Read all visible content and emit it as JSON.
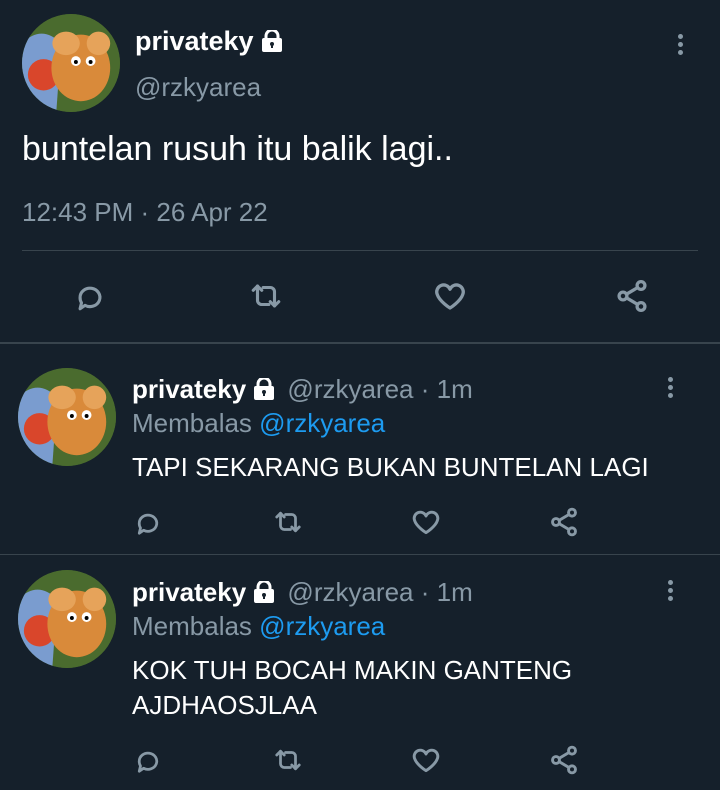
{
  "main_tweet": {
    "display_name": "privateky",
    "handle": "@rzkyarea",
    "text": "buntelan rusuh itu balik lagi..",
    "timestamp": "12:43 PM · 26 Apr 22"
  },
  "replies": [
    {
      "display_name": "privateky",
      "handle": "@rzkyarea",
      "time": "· 1m",
      "replying_prefix": "Membalas",
      "replying_to": "@rzkyarea",
      "text": "TAPI SEKARANG BUKAN BUNTELAN LAGI"
    },
    {
      "display_name": "privateky",
      "handle": "@rzkyarea",
      "time": "· 1m",
      "replying_prefix": "Membalas",
      "replying_to": "@rzkyarea",
      "text_line1": "KOK TUH BOCAH MAKIN GANTENG",
      "text_line2": "AJDHAOSJLAA"
    }
  ],
  "icons": [
    "lock-icon",
    "more-icon",
    "reply-icon",
    "retweet-icon",
    "like-icon",
    "share-icon"
  ],
  "colors": {
    "background": "#15202b",
    "muted": "#8899a6",
    "link": "#1d9bf0",
    "divider": "#38444d"
  }
}
